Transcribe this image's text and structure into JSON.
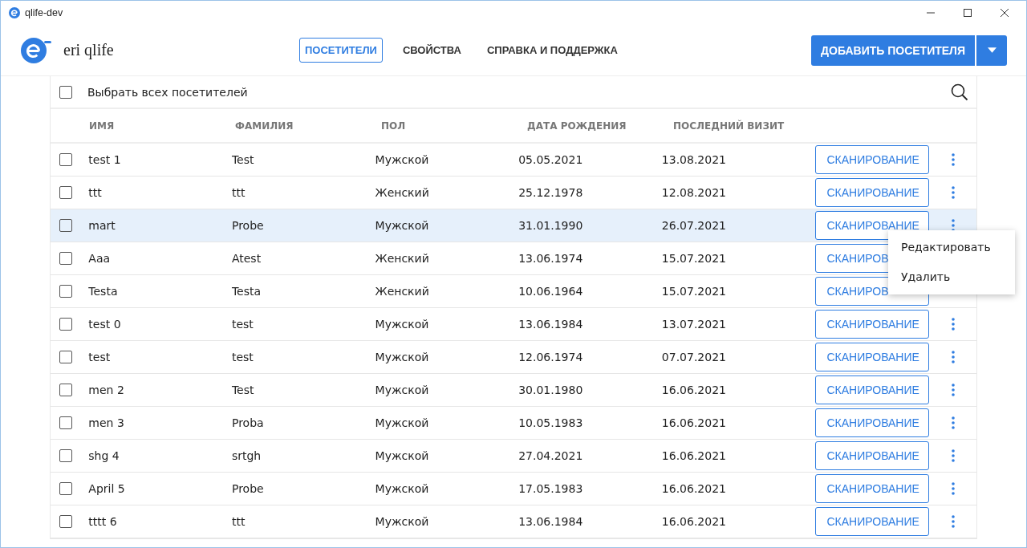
{
  "window": {
    "title": "qlife-dev"
  },
  "header": {
    "logo_text": "eri qlife",
    "nav": [
      {
        "label": "ПОСЕТИТЕЛИ",
        "selected": true
      },
      {
        "label": "СВОЙСТВА",
        "selected": false
      },
      {
        "label": "СПРАВКА И ПОДДЕРЖКА",
        "selected": false
      }
    ],
    "add_button": "ДОБАВИТЬ ПОСЕТИТЕЛЯ"
  },
  "select_all": {
    "label": "Выбрать всех посетителей",
    "checked": false
  },
  "table": {
    "columns": [
      "ИМЯ",
      "ФАМИЛИЯ",
      "ПОЛ",
      "ДАТА РОЖДЕНИЯ",
      "ПОСЛЕДНИЙ ВИЗИТ"
    ],
    "rows": [
      {
        "cells": [
          "test 1",
          "Test",
          "Мужской",
          "05.05.2021",
          "13.08.2021"
        ],
        "action": "СКАНИРОВАНИЕ",
        "checked": false,
        "selected": false,
        "menu_icon": true
      },
      {
        "cells": [
          "ttt",
          "ttt",
          "Женский",
          "25.12.1978",
          "12.08.2021"
        ],
        "action": "СКАНИРОВАНИЕ",
        "checked": false,
        "selected": false,
        "menu_icon": true
      },
      {
        "cells": [
          "mart",
          "Probe",
          "Мужской",
          "31.01.1990",
          "26.07.2021"
        ],
        "action": "СКАНИРОВАНИЕ",
        "checked": false,
        "selected": true,
        "menu_icon": true
      },
      {
        "cells": [
          "Aaa",
          "Atest",
          "Женский",
          "13.06.1974",
          "15.07.2021"
        ],
        "action": "СКАНИРОВ",
        "checked": false,
        "selected": false,
        "menu_icon": false
      },
      {
        "cells": [
          "Testa",
          "Testa",
          "Женский",
          "10.06.1964",
          "15.07.2021"
        ],
        "action": "СКАНИРОВ",
        "checked": false,
        "selected": false,
        "menu_icon": false
      },
      {
        "cells": [
          "test 0",
          "test",
          "Мужской",
          "13.06.1984",
          "13.07.2021"
        ],
        "action": "СКАНИРОВАНИЕ",
        "checked": false,
        "selected": false,
        "menu_icon": true
      },
      {
        "cells": [
          "test",
          "test",
          "Мужской",
          "12.06.1974",
          "07.07.2021"
        ],
        "action": "СКАНИРОВАНИЕ",
        "checked": false,
        "selected": false,
        "menu_icon": true
      },
      {
        "cells": [
          "men 2",
          "Test",
          "Мужской",
          "30.01.1980",
          "16.06.2021"
        ],
        "action": "СКАНИРОВАНИЕ",
        "checked": false,
        "selected": false,
        "menu_icon": true
      },
      {
        "cells": [
          "men 3",
          "Proba",
          "Мужской",
          "10.05.1983",
          "16.06.2021"
        ],
        "action": "СКАНИРОВАНИЕ",
        "checked": false,
        "selected": false,
        "menu_icon": true
      },
      {
        "cells": [
          "shg 4",
          "srtgh",
          "Мужской",
          "27.04.2021",
          "16.06.2021"
        ],
        "action": "СКАНИРОВАНИЕ",
        "checked": false,
        "selected": false,
        "menu_icon": true
      },
      {
        "cells": [
          "April 5",
          "Probe",
          "Мужской",
          "17.05.1983",
          "16.06.2021"
        ],
        "action": "СКАНИРОВАНИЕ",
        "checked": false,
        "selected": false,
        "menu_icon": true
      },
      {
        "cells": [
          "tttt 6",
          "ttt",
          "Мужской",
          "13.06.1984",
          "16.06.2021"
        ],
        "action": "СКАНИРОВАНИЕ",
        "checked": false,
        "selected": false,
        "menu_icon": true
      }
    ]
  },
  "context_menu": {
    "items": [
      "Редактировать",
      "Удалить"
    ]
  }
}
